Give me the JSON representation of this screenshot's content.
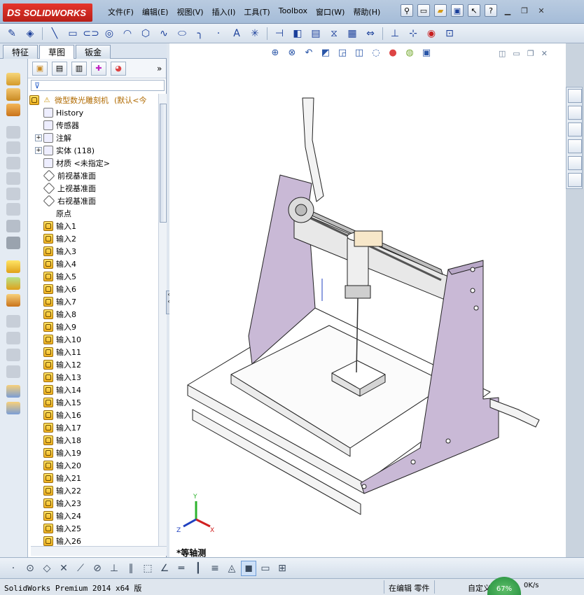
{
  "app": {
    "logo_brand": "SOLIDWORKS",
    "logo_mark": "DS",
    "menus": [
      "文件(F)",
      "编辑(E)",
      "视图(V)",
      "插入(I)",
      "工具(T)",
      "Toolbox",
      "窗口(W)",
      "帮助(H)"
    ],
    "help_glyph": "?"
  },
  "left_tabs": [
    "特征",
    "草图",
    "钣金"
  ],
  "feature_tree": {
    "root": "微型数光雕刻机",
    "root_suffix": "(默认<今",
    "items": [
      {
        "label": "History",
        "icon": "history-icon"
      },
      {
        "label": "传感器",
        "icon": "sensor-icon"
      },
      {
        "label": "注解",
        "icon": "annotations-icon",
        "expand": "+"
      },
      {
        "label": "实体 (118)",
        "icon": "solid-bodies-icon",
        "expand": "+"
      },
      {
        "label": "材质 <未指定>",
        "icon": "material-icon"
      },
      {
        "label": "前视基准面",
        "icon": "plane-icon"
      },
      {
        "label": "上视基准面",
        "icon": "plane-icon"
      },
      {
        "label": "右视基准面",
        "icon": "plane-icon"
      },
      {
        "label": "原点",
        "icon": "origin-icon"
      }
    ],
    "imports": [
      "输入1",
      "输入2",
      "输入3",
      "输入4",
      "输入5",
      "输入6",
      "输入7",
      "输入8",
      "输入9",
      "输入10",
      "输入11",
      "输入12",
      "输入13",
      "输入14",
      "输入15",
      "输入16",
      "输入17",
      "输入18",
      "输入19",
      "输入20",
      "输入21",
      "输入22",
      "输入23",
      "输入24",
      "输入25",
      "输入26"
    ]
  },
  "graphics": {
    "view_name": "*等轴测",
    "triad": {
      "x": "X",
      "y": "Y",
      "z": "Z"
    }
  },
  "status": {
    "app_name": "SolidWorks Premium 2014 x64 版",
    "mode": "在编辑 零件",
    "units": "自定义",
    "badge": "67%",
    "net": "0K/s"
  },
  "colors": {
    "frame_lilac": "#c9b9d6",
    "title_blue": "#a5bcd8",
    "accent_red": "#d0281f"
  }
}
